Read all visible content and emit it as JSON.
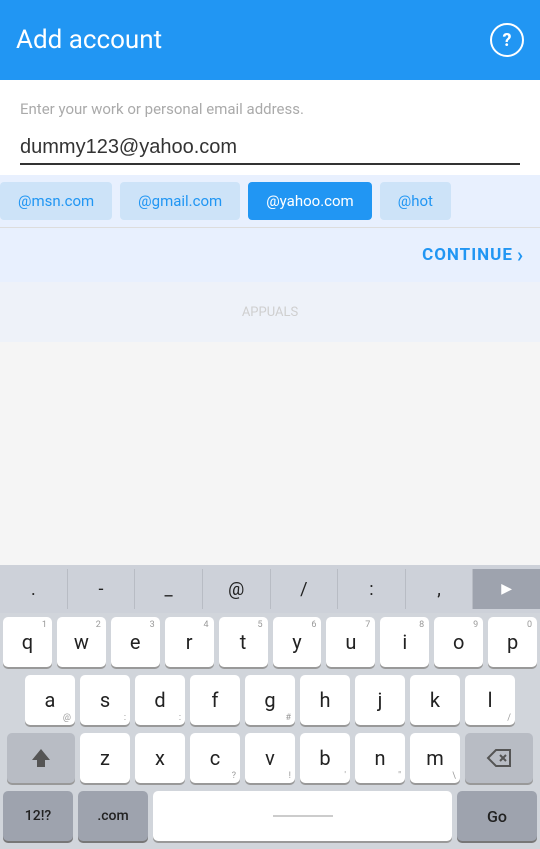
{
  "header": {
    "title": "Add account",
    "help_icon": "?"
  },
  "form": {
    "hint": "Enter your work or personal email address.",
    "email_value": "dummy123@yahoo.com"
  },
  "chips": [
    {
      "label": "@msn.com",
      "active": false,
      "partial": true
    },
    {
      "label": "@gmail.com",
      "active": false
    },
    {
      "label": "@yahoo.com",
      "active": true
    },
    {
      "label": "@hot",
      "active": false,
      "partial": true
    }
  ],
  "continue_button": {
    "label": "CONTINUE"
  },
  "keyboard": {
    "sym_row": [
      ".",
      "-",
      "_",
      "@",
      "/",
      ":",
      ","
    ],
    "row1": [
      {
        "char": "q",
        "num": "1"
      },
      {
        "char": "w",
        "num": "2"
      },
      {
        "char": "e",
        "num": "3"
      },
      {
        "char": "r",
        "num": "4"
      },
      {
        "char": "t",
        "num": "5"
      },
      {
        "char": "y",
        "num": "6"
      },
      {
        "char": "u",
        "num": "7"
      },
      {
        "char": "i",
        "num": "8"
      },
      {
        "char": "o",
        "num": "9"
      },
      {
        "char": "p",
        "num": "0"
      }
    ],
    "row2": [
      {
        "char": "a",
        "sub": "@"
      },
      {
        "char": "s",
        "sub": ":"
      },
      {
        "char": "d",
        "sub": ":"
      },
      {
        "char": "f"
      },
      {
        "char": "g",
        "sub": "#"
      },
      {
        "char": "h"
      },
      {
        "char": "j"
      },
      {
        "char": "k"
      },
      {
        "char": "l",
        "sub": "/"
      }
    ],
    "row3": [
      {
        "char": "z"
      },
      {
        "char": "x"
      },
      {
        "char": "c",
        "sub": "?"
      },
      {
        "char": "v",
        "sub": "!"
      },
      {
        "char": "b",
        "sub": "'"
      },
      {
        "char": "n",
        "sub": "\""
      },
      {
        "char": "m",
        "sub": "\\"
      }
    ],
    "bottom": {
      "numeric": "12!?",
      "dotcom": ".com",
      "space": "",
      "go": "Go"
    }
  },
  "colors": {
    "primary": "#2196F3",
    "header_bg": "#2196F3",
    "chip_active_bg": "#2196F3",
    "chip_inactive_bg": "#cde3f8"
  }
}
